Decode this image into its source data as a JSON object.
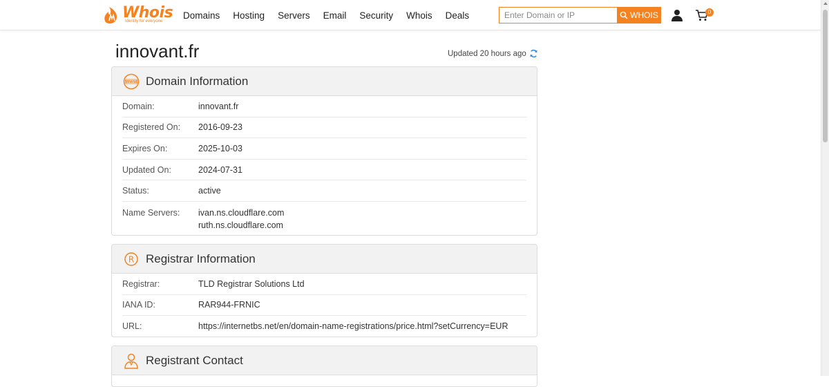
{
  "header": {
    "logo_text": "Whois",
    "logo_tagline": "Identity for everyone",
    "nav": [
      "Domains",
      "Hosting",
      "Servers",
      "Email",
      "Security",
      "Whois",
      "Deals"
    ],
    "search_placeholder": "Enter Domain or IP",
    "search_button": "WHOIS",
    "cart_count": "0"
  },
  "page": {
    "title": "innovant.fr",
    "updated": "Updated 20 hours ago"
  },
  "domain_info": {
    "title": "Domain Information",
    "rows": [
      {
        "label": "Domain:",
        "value": "innovant.fr"
      },
      {
        "label": "Registered On:",
        "value": "2016-09-23"
      },
      {
        "label": "Expires On:",
        "value": "2025-10-03"
      },
      {
        "label": "Updated On:",
        "value": "2024-07-31"
      },
      {
        "label": "Status:",
        "value": "active"
      }
    ],
    "nameservers_label": "Name Servers:",
    "nameservers": [
      "ivan.ns.cloudflare.com",
      "ruth.ns.cloudflare.com"
    ]
  },
  "registrar_info": {
    "title": "Registrar Information",
    "rows": [
      {
        "label": "Registrar:",
        "value": "TLD Registrar Solutions Ltd"
      },
      {
        "label": "IANA ID:",
        "value": "RAR944-FRNIC"
      },
      {
        "label": "URL:",
        "value": "https://internetbs.net/en/domain-name-registrations/price.html?setCurrency=EUR"
      }
    ]
  },
  "registrant_contact": {
    "title": "Registrant Contact"
  },
  "colors": {
    "accent": "#f58220",
    "panel_header": "#f2f2f2",
    "refresh_icon": "#3a8fd9"
  },
  "icons": {
    "domain": "www-icon",
    "registrar": "registered-icon",
    "registrant": "person-icon",
    "user": "user-icon",
    "cart": "cart-icon",
    "search": "search-icon",
    "refresh": "refresh-icon"
  }
}
